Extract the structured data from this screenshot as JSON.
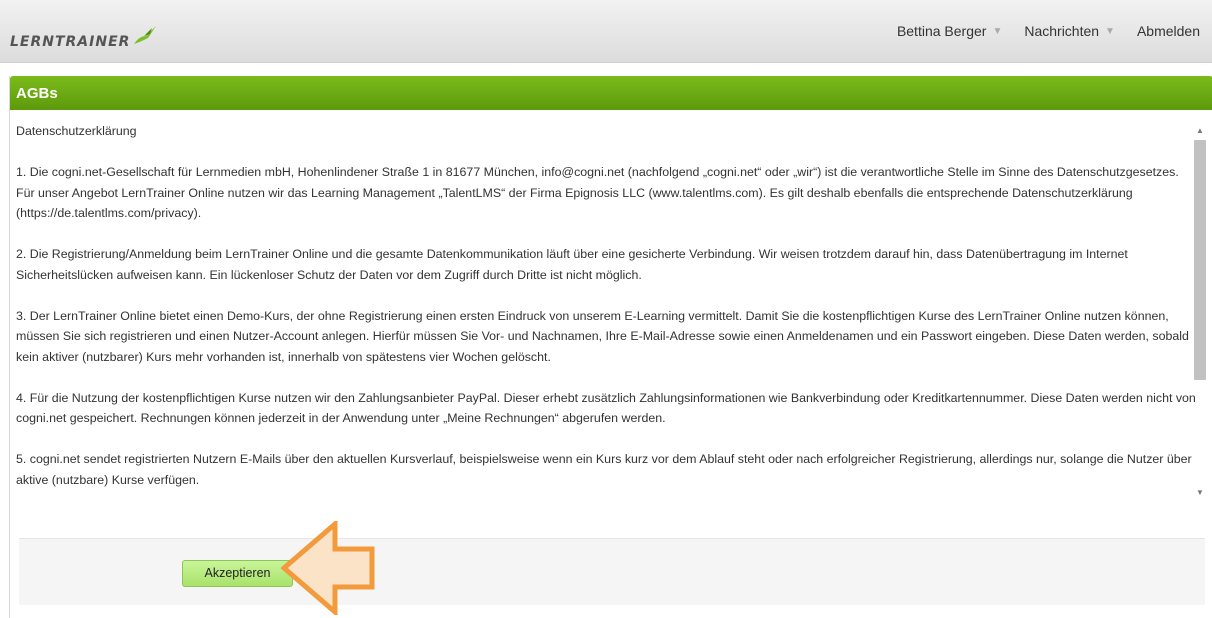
{
  "header": {
    "logo_text": "LERNTRAINER",
    "nav": {
      "user": "Bettina Berger",
      "messages": "Nachrichten",
      "logout": "Abmelden"
    }
  },
  "panel": {
    "title": "AGBs",
    "paragraphs": [
      "Datenschutzerklärung",
      "1. Die cogni.net-Gesellschaft für Lernmedien mbH, Hohenlindener Straße 1 in 81677 München, info@cogni.net (nachfolgend „cogni.net“ oder „wir“) ist die verantwortliche Stelle im Sinne des Datenschutzgesetzes. Für unser Angebot LernTrainer Online nutzen wir das Learning Management „TalentLMS“ der Firma Epignosis LLC (www.talentlms.com). Es gilt deshalb ebenfalls die entsprechende Datenschutzerklärung (https://de.talentlms.com/privacy).",
      "2. Die Registrierung/Anmeldung beim LernTrainer Online und die gesamte Datenkommunikation läuft über eine gesicherte Verbindung. Wir weisen trotzdem darauf hin, dass Datenübertragung im Internet Sicherheitslücken aufweisen kann. Ein lückenloser Schutz der Daten vor dem Zugriff durch Dritte ist nicht möglich.",
      "3. Der LernTrainer Online bietet einen Demo-Kurs, der ohne Registrierung einen ersten Eindruck von unserem E-Learning vermittelt. Damit Sie die kostenpflichtigen Kurse des LernTrainer Online nutzen können, müssen Sie sich registrieren und einen Nutzer-Account anlegen. Hierfür müssen Sie Vor- und Nachnamen, Ihre E-Mail-Adresse sowie einen Anmeldenamen und ein Passwort eingeben. Diese Daten werden, sobald kein aktiver (nutzbarer) Kurs mehr vorhanden ist, innerhalb von spätestens vier Wochen gelöscht.",
      "4. Für die Nutzung der kostenpflichtigen Kurse nutzen wir den Zahlungsanbieter PayPal. Dieser erhebt zusätzlich Zahlungsinformationen wie Bankverbindung oder Kreditkartennummer. Diese Daten werden nicht von cogni.net gespeichert. Rechnungen können jederzeit in der Anwendung unter „Meine Rechnungen“ abgerufen werden.",
      "5. cogni.net sendet registrierten Nutzern E-Mails über den aktuellen Kursverlauf, beispielsweise wenn ein Kurs kurz vor dem Ablauf steht oder nach erfolgreicher Registrierung, allerdings nur, solange die Nutzer über aktive (nutzbare) Kurse verfügen."
    ],
    "accept_label": "Akzeptieren"
  },
  "icons": {
    "logo": "hummingbird-logo",
    "caret": "caret-down-icon",
    "arrow": "left-arrow-hint"
  },
  "colors": {
    "header_green": "#6aab12",
    "accent_orange": "#f5a04a",
    "button_green": "#b6ea7d"
  }
}
